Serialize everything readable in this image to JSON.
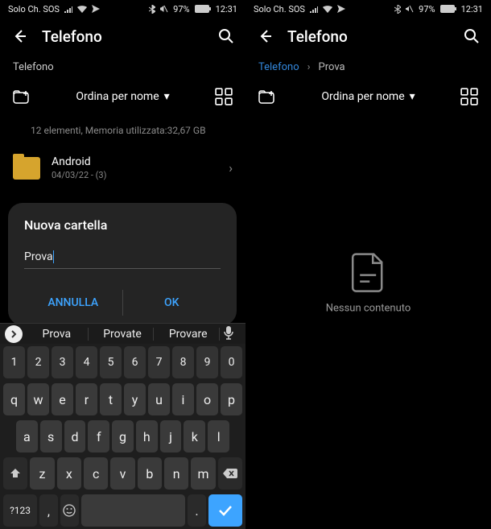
{
  "status": {
    "carrier": "Solo Ch. SOS",
    "battery_pct": "97%",
    "time": "12:31"
  },
  "left": {
    "header_title": "Telefono",
    "breadcrumb": [
      "Telefono"
    ],
    "sort_label": "Ordina per nome",
    "summary": "12 elementi, Memoria utilizzata:32,67 GB",
    "folder": {
      "name": "Android",
      "meta": "04/03/22 - (3)"
    },
    "dialog": {
      "title": "Nuova cartella",
      "value": "Prova",
      "cancel": "ANNULLA",
      "ok": "OK"
    },
    "keyboard": {
      "suggestions": [
        "Prova",
        "Provate",
        "Provare"
      ],
      "num_row": [
        "1",
        "2",
        "3",
        "4",
        "5",
        "6",
        "7",
        "8",
        "9",
        "0"
      ],
      "row1": [
        "q",
        "w",
        "e",
        "r",
        "t",
        "y",
        "u",
        "i",
        "o",
        "p"
      ],
      "row2": [
        "a",
        "s",
        "d",
        "f",
        "g",
        "h",
        "j",
        "k",
        "l"
      ],
      "row3": [
        "z",
        "x",
        "c",
        "v",
        "b",
        "n",
        "m"
      ],
      "symkey": "?123",
      "comma": ",",
      "period": "."
    }
  },
  "right": {
    "header_title": "Telefono",
    "breadcrumb": [
      "Telefono",
      "Prova"
    ],
    "sort_label": "Ordina per nome",
    "empty_label": "Nessun contenuto"
  },
  "icons": {
    "back": "←",
    "search": "⌕",
    "grid": "▦",
    "chevdown": "▾",
    "chevright": "›",
    "breadcrumb_sep": "›"
  }
}
